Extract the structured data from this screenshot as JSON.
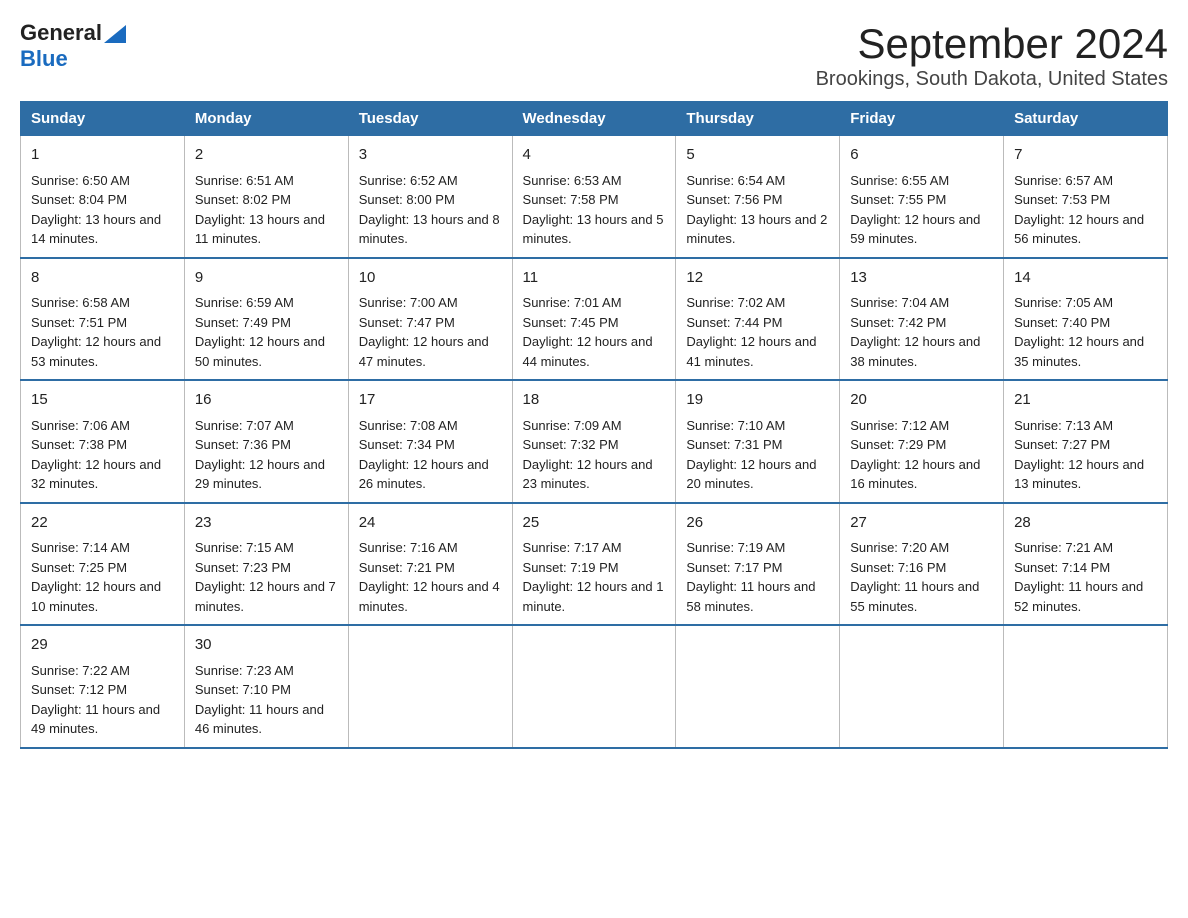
{
  "header": {
    "logo_general": "General",
    "logo_blue": "Blue",
    "title": "September 2024",
    "subtitle": "Brookings, South Dakota, United States"
  },
  "days_of_week": [
    "Sunday",
    "Monday",
    "Tuesday",
    "Wednesday",
    "Thursday",
    "Friday",
    "Saturday"
  ],
  "weeks": [
    [
      {
        "day": "1",
        "sunrise": "6:50 AM",
        "sunset": "8:04 PM",
        "daylight": "13 hours and 14 minutes."
      },
      {
        "day": "2",
        "sunrise": "6:51 AM",
        "sunset": "8:02 PM",
        "daylight": "13 hours and 11 minutes."
      },
      {
        "day": "3",
        "sunrise": "6:52 AM",
        "sunset": "8:00 PM",
        "daylight": "13 hours and 8 minutes."
      },
      {
        "day": "4",
        "sunrise": "6:53 AM",
        "sunset": "7:58 PM",
        "daylight": "13 hours and 5 minutes."
      },
      {
        "day": "5",
        "sunrise": "6:54 AM",
        "sunset": "7:56 PM",
        "daylight": "13 hours and 2 minutes."
      },
      {
        "day": "6",
        "sunrise": "6:55 AM",
        "sunset": "7:55 PM",
        "daylight": "12 hours and 59 minutes."
      },
      {
        "day": "7",
        "sunrise": "6:57 AM",
        "sunset": "7:53 PM",
        "daylight": "12 hours and 56 minutes."
      }
    ],
    [
      {
        "day": "8",
        "sunrise": "6:58 AM",
        "sunset": "7:51 PM",
        "daylight": "12 hours and 53 minutes."
      },
      {
        "day": "9",
        "sunrise": "6:59 AM",
        "sunset": "7:49 PM",
        "daylight": "12 hours and 50 minutes."
      },
      {
        "day": "10",
        "sunrise": "7:00 AM",
        "sunset": "7:47 PM",
        "daylight": "12 hours and 47 minutes."
      },
      {
        "day": "11",
        "sunrise": "7:01 AM",
        "sunset": "7:45 PM",
        "daylight": "12 hours and 44 minutes."
      },
      {
        "day": "12",
        "sunrise": "7:02 AM",
        "sunset": "7:44 PM",
        "daylight": "12 hours and 41 minutes."
      },
      {
        "day": "13",
        "sunrise": "7:04 AM",
        "sunset": "7:42 PM",
        "daylight": "12 hours and 38 minutes."
      },
      {
        "day": "14",
        "sunrise": "7:05 AM",
        "sunset": "7:40 PM",
        "daylight": "12 hours and 35 minutes."
      }
    ],
    [
      {
        "day": "15",
        "sunrise": "7:06 AM",
        "sunset": "7:38 PM",
        "daylight": "12 hours and 32 minutes."
      },
      {
        "day": "16",
        "sunrise": "7:07 AM",
        "sunset": "7:36 PM",
        "daylight": "12 hours and 29 minutes."
      },
      {
        "day": "17",
        "sunrise": "7:08 AM",
        "sunset": "7:34 PM",
        "daylight": "12 hours and 26 minutes."
      },
      {
        "day": "18",
        "sunrise": "7:09 AM",
        "sunset": "7:32 PM",
        "daylight": "12 hours and 23 minutes."
      },
      {
        "day": "19",
        "sunrise": "7:10 AM",
        "sunset": "7:31 PM",
        "daylight": "12 hours and 20 minutes."
      },
      {
        "day": "20",
        "sunrise": "7:12 AM",
        "sunset": "7:29 PM",
        "daylight": "12 hours and 16 minutes."
      },
      {
        "day": "21",
        "sunrise": "7:13 AM",
        "sunset": "7:27 PM",
        "daylight": "12 hours and 13 minutes."
      }
    ],
    [
      {
        "day": "22",
        "sunrise": "7:14 AM",
        "sunset": "7:25 PM",
        "daylight": "12 hours and 10 minutes."
      },
      {
        "day": "23",
        "sunrise": "7:15 AM",
        "sunset": "7:23 PM",
        "daylight": "12 hours and 7 minutes."
      },
      {
        "day": "24",
        "sunrise": "7:16 AM",
        "sunset": "7:21 PM",
        "daylight": "12 hours and 4 minutes."
      },
      {
        "day": "25",
        "sunrise": "7:17 AM",
        "sunset": "7:19 PM",
        "daylight": "12 hours and 1 minute."
      },
      {
        "day": "26",
        "sunrise": "7:19 AM",
        "sunset": "7:17 PM",
        "daylight": "11 hours and 58 minutes."
      },
      {
        "day": "27",
        "sunrise": "7:20 AM",
        "sunset": "7:16 PM",
        "daylight": "11 hours and 55 minutes."
      },
      {
        "day": "28",
        "sunrise": "7:21 AM",
        "sunset": "7:14 PM",
        "daylight": "11 hours and 52 minutes."
      }
    ],
    [
      {
        "day": "29",
        "sunrise": "7:22 AM",
        "sunset": "7:12 PM",
        "daylight": "11 hours and 49 minutes."
      },
      {
        "day": "30",
        "sunrise": "7:23 AM",
        "sunset": "7:10 PM",
        "daylight": "11 hours and 46 minutes."
      },
      null,
      null,
      null,
      null,
      null
    ]
  ]
}
